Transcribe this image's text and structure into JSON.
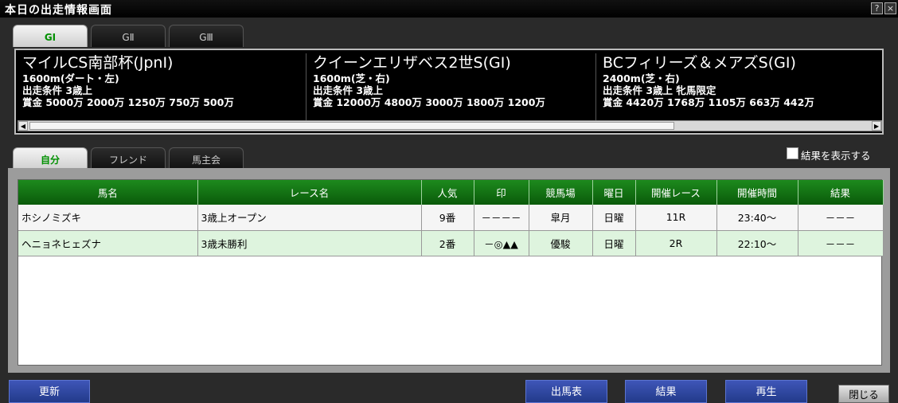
{
  "window": {
    "title": "本日の出走情報画面",
    "help_label": "?",
    "close_label": "×"
  },
  "grade_tabs": [
    {
      "label": "GⅠ",
      "active": true
    },
    {
      "label": "GⅡ",
      "active": false
    },
    {
      "label": "GⅢ",
      "active": false
    }
  ],
  "races": [
    {
      "name": "マイルCS南部杯(JpnⅠ)",
      "course": "1600m(ダート・左)",
      "condition": "出走条件 3歳上",
      "prize": "賞金  5000万 2000万 1250万 750万 500万"
    },
    {
      "name": "クイーンエリザベス2世S(GⅠ)",
      "course": "1600m(芝・右)",
      "condition": "出走条件 3歳上",
      "prize": "賞金  12000万 4800万 3000万 1800万 1200万"
    },
    {
      "name": "BCフィリーズ＆メアズS(GⅠ)",
      "course": "2400m(芝・右)",
      "condition": "出走条件 3歳上 牝馬限定",
      "prize": "賞金  4420万 1768万 1105万 663万 442万"
    }
  ],
  "filter_tabs": [
    {
      "label": "自分",
      "active": true
    },
    {
      "label": "フレンド",
      "active": false
    },
    {
      "label": "馬主会",
      "active": false
    }
  ],
  "show_results_label": "結果を表示する",
  "table": {
    "columns": [
      "馬名",
      "レース名",
      "人気",
      "印",
      "競馬場",
      "曜日",
      "開催レース",
      "開催時間",
      "結果"
    ],
    "rows": [
      [
        "ホシノミズキ",
        "3歳上オープン",
        "9番",
        "－－－－",
        "皐月",
        "日曜",
        "11R",
        "23:40～",
        "－－－"
      ],
      [
        "ヘニョネヒェズナ",
        "3歳未勝利",
        "2番",
        "－◎▲▲",
        "優駿",
        "日曜",
        "2R",
        "22:10～",
        "－－－"
      ]
    ]
  },
  "buttons": {
    "refresh": "更新",
    "race_card": "出馬表",
    "results": "結果",
    "replay": "再生",
    "close": "閉じる"
  }
}
